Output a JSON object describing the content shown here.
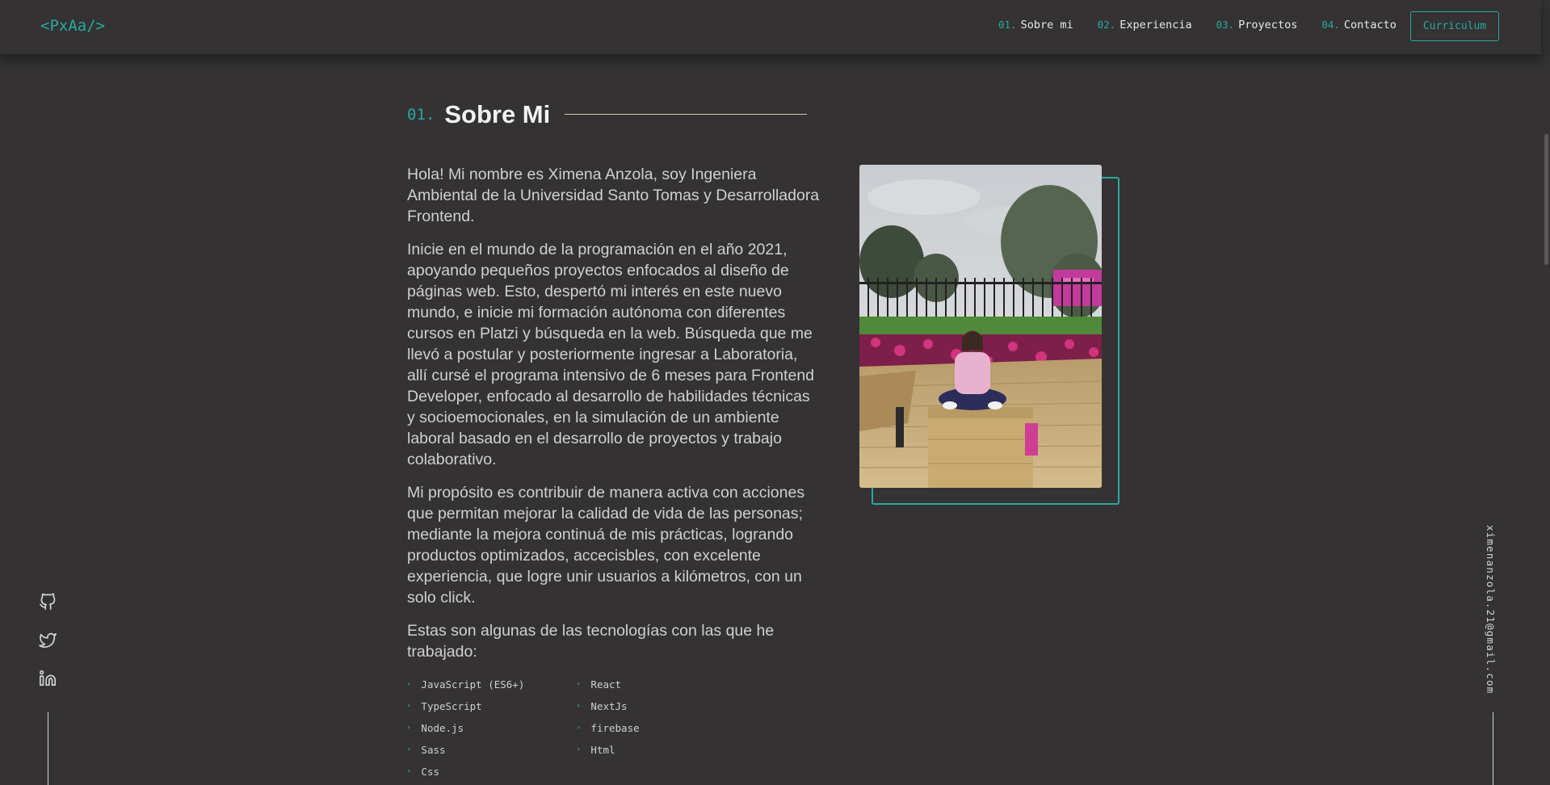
{
  "header": {
    "logo": "<PxAa/>",
    "nav": [
      {
        "num": "01.",
        "label": "Sobre mi"
      },
      {
        "num": "02.",
        "label": "Experiencia"
      },
      {
        "num": "03.",
        "label": "Proyectos"
      },
      {
        "num": "04.",
        "label": "Contacto"
      }
    ],
    "cv_button": "Curriculum"
  },
  "section": {
    "num": "01.",
    "title": "Sobre Mi"
  },
  "paragraphs": [
    "Hola! Mi nombre es Ximena Anzola, soy Ingeniera Ambiental de la Universidad Santo Tomas y Desarrolladora Frontend.",
    "Inicie en el mundo de la programación en el año 2021, apoyando pequeños proyectos enfocados al diseño de páginas web. Esto, despertó mi interés en este nuevo mundo, e inicie mi formación autónoma con diferentes cursos en Platzi y búsqueda en la web. Búsqueda que me llevó a postular y posteriormente ingresar a Laboratoria, allí cursé el programa intensivo de 6 meses para Frontend Developer, enfocado al desarrollo de habilidades técnicas y socioemocionales, en la simulación de un ambiente laboral basado en el desarrollo de proyectos y trabajo colaborativo.",
    "Mi propósito es contribuir de manera activa con acciones que permitan mejorar la calidad de vida de las personas; mediante la mejora continuá de mis prácticas, logrando productos optimizados, accecisbles, con excelente experiencia, que logre unir usuarios a kilómetros, con un solo click.",
    "Estas son algunas de las tecnologías con las que he trabajado:"
  ],
  "technologies": [
    "JavaScript (ES6+)",
    "React",
    "TypeScript",
    "NextJs",
    "Node.js",
    "firebase",
    "Sass",
    "Html",
    "Css"
  ],
  "social": {
    "icons": [
      "github-icon",
      "twitter-icon",
      "linkedin-icon"
    ],
    "email": "ximenanzola.21@gmail.com"
  },
  "colors": {
    "background": "#343233",
    "accent": "#2aa8a3",
    "title_line": "#d9c69f"
  }
}
